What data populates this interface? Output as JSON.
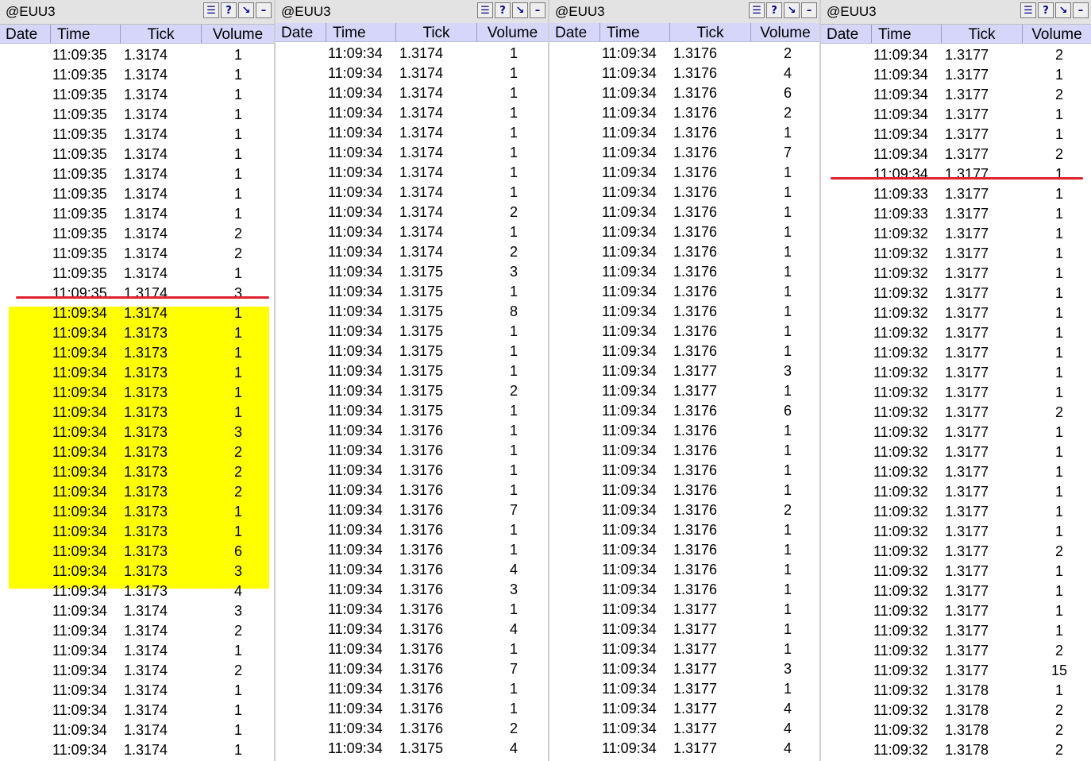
{
  "panels": [
    {
      "title": "@EUU3",
      "columns": [
        "Date",
        "Time",
        "Tick",
        "Volume"
      ],
      "highlight": {
        "from": 13,
        "to": 26,
        "color": "#ffff00"
      },
      "red_line_after_row": 12,
      "rows": [
        [
          "11:09:35",
          "1.3174",
          "1"
        ],
        [
          "11:09:35",
          "1.3174",
          "1"
        ],
        [
          "11:09:35",
          "1.3174",
          "1"
        ],
        [
          "11:09:35",
          "1.3174",
          "1"
        ],
        [
          "11:09:35",
          "1.3174",
          "1"
        ],
        [
          "11:09:35",
          "1.3174",
          "1"
        ],
        [
          "11:09:35",
          "1.3174",
          "1"
        ],
        [
          "11:09:35",
          "1.3174",
          "1"
        ],
        [
          "11:09:35",
          "1.3174",
          "1"
        ],
        [
          "11:09:35",
          "1.3174",
          "2"
        ],
        [
          "11:09:35",
          "1.3174",
          "2"
        ],
        [
          "11:09:35",
          "1.3174",
          "1"
        ],
        [
          "11:09:35",
          "1.3174",
          "3"
        ],
        [
          "11:09:34",
          "1.3174",
          "1"
        ],
        [
          "11:09:34",
          "1.3173",
          "1"
        ],
        [
          "11:09:34",
          "1.3173",
          "1"
        ],
        [
          "11:09:34",
          "1.3173",
          "1"
        ],
        [
          "11:09:34",
          "1.3173",
          "1"
        ],
        [
          "11:09:34",
          "1.3173",
          "1"
        ],
        [
          "11:09:34",
          "1.3173",
          "3"
        ],
        [
          "11:09:34",
          "1.3173",
          "2"
        ],
        [
          "11:09:34",
          "1.3173",
          "2"
        ],
        [
          "11:09:34",
          "1.3173",
          "2"
        ],
        [
          "11:09:34",
          "1.3173",
          "1"
        ],
        [
          "11:09:34",
          "1.3173",
          "1"
        ],
        [
          "11:09:34",
          "1.3173",
          "6"
        ],
        [
          "11:09:34",
          "1.3173",
          "3"
        ],
        [
          "11:09:34",
          "1.3173",
          "4"
        ],
        [
          "11:09:34",
          "1.3174",
          "3"
        ],
        [
          "11:09:34",
          "1.3174",
          "2"
        ],
        [
          "11:09:34",
          "1.3174",
          "1"
        ],
        [
          "11:09:34",
          "1.3174",
          "2"
        ],
        [
          "11:09:34",
          "1.3174",
          "1"
        ],
        [
          "11:09:34",
          "1.3174",
          "1"
        ],
        [
          "11:09:34",
          "1.3174",
          "1"
        ],
        [
          "11:09:34",
          "1.3174",
          "1"
        ]
      ]
    },
    {
      "title": "@EUU3",
      "columns": [
        "Date",
        "Time",
        "Tick",
        "Volume"
      ],
      "highlight": null,
      "red_line_after_row": null,
      "rows": [
        [
          "11:09:34",
          "1.3174",
          "1"
        ],
        [
          "11:09:34",
          "1.3174",
          "1"
        ],
        [
          "11:09:34",
          "1.3174",
          "1"
        ],
        [
          "11:09:34",
          "1.3174",
          "1"
        ],
        [
          "11:09:34",
          "1.3174",
          "1"
        ],
        [
          "11:09:34",
          "1.3174",
          "1"
        ],
        [
          "11:09:34",
          "1.3174",
          "1"
        ],
        [
          "11:09:34",
          "1.3174",
          "1"
        ],
        [
          "11:09:34",
          "1.3174",
          "2"
        ],
        [
          "11:09:34",
          "1.3174",
          "1"
        ],
        [
          "11:09:34",
          "1.3174",
          "2"
        ],
        [
          "11:09:34",
          "1.3175",
          "3"
        ],
        [
          "11:09:34",
          "1.3175",
          "1"
        ],
        [
          "11:09:34",
          "1.3175",
          "8"
        ],
        [
          "11:09:34",
          "1.3175",
          "1"
        ],
        [
          "11:09:34",
          "1.3175",
          "1"
        ],
        [
          "11:09:34",
          "1.3175",
          "1"
        ],
        [
          "11:09:34",
          "1.3175",
          "2"
        ],
        [
          "11:09:34",
          "1.3175",
          "1"
        ],
        [
          "11:09:34",
          "1.3176",
          "1"
        ],
        [
          "11:09:34",
          "1.3176",
          "1"
        ],
        [
          "11:09:34",
          "1.3176",
          "1"
        ],
        [
          "11:09:34",
          "1.3176",
          "1"
        ],
        [
          "11:09:34",
          "1.3176",
          "7"
        ],
        [
          "11:09:34",
          "1.3176",
          "1"
        ],
        [
          "11:09:34",
          "1.3176",
          "1"
        ],
        [
          "11:09:34",
          "1.3176",
          "4"
        ],
        [
          "11:09:34",
          "1.3176",
          "3"
        ],
        [
          "11:09:34",
          "1.3176",
          "1"
        ],
        [
          "11:09:34",
          "1.3176",
          "4"
        ],
        [
          "11:09:34",
          "1.3176",
          "1"
        ],
        [
          "11:09:34",
          "1.3176",
          "7"
        ],
        [
          "11:09:34",
          "1.3176",
          "1"
        ],
        [
          "11:09:34",
          "1.3176",
          "1"
        ],
        [
          "11:09:34",
          "1.3176",
          "2"
        ],
        [
          "11:09:34",
          "1.3175",
          "4"
        ]
      ]
    },
    {
      "title": "@EUU3",
      "columns": [
        "Date",
        "Time",
        "Tick",
        "Volume"
      ],
      "highlight": null,
      "red_line_after_row": null,
      "rows": [
        [
          "11:09:34",
          "1.3176",
          "2"
        ],
        [
          "11:09:34",
          "1.3176",
          "4"
        ],
        [
          "11:09:34",
          "1.3176",
          "6"
        ],
        [
          "11:09:34",
          "1.3176",
          "2"
        ],
        [
          "11:09:34",
          "1.3176",
          "1"
        ],
        [
          "11:09:34",
          "1.3176",
          "7"
        ],
        [
          "11:09:34",
          "1.3176",
          "1"
        ],
        [
          "11:09:34",
          "1.3176",
          "1"
        ],
        [
          "11:09:34",
          "1.3176",
          "1"
        ],
        [
          "11:09:34",
          "1.3176",
          "1"
        ],
        [
          "11:09:34",
          "1.3176",
          "1"
        ],
        [
          "11:09:34",
          "1.3176",
          "1"
        ],
        [
          "11:09:34",
          "1.3176",
          "1"
        ],
        [
          "11:09:34",
          "1.3176",
          "1"
        ],
        [
          "11:09:34",
          "1.3176",
          "1"
        ],
        [
          "11:09:34",
          "1.3176",
          "1"
        ],
        [
          "11:09:34",
          "1.3177",
          "3"
        ],
        [
          "11:09:34",
          "1.3177",
          "1"
        ],
        [
          "11:09:34",
          "1.3176",
          "6"
        ],
        [
          "11:09:34",
          "1.3176",
          "1"
        ],
        [
          "11:09:34",
          "1.3176",
          "1"
        ],
        [
          "11:09:34",
          "1.3176",
          "1"
        ],
        [
          "11:09:34",
          "1.3176",
          "1"
        ],
        [
          "11:09:34",
          "1.3176",
          "2"
        ],
        [
          "11:09:34",
          "1.3176",
          "1"
        ],
        [
          "11:09:34",
          "1.3176",
          "1"
        ],
        [
          "11:09:34",
          "1.3176",
          "1"
        ],
        [
          "11:09:34",
          "1.3176",
          "1"
        ],
        [
          "11:09:34",
          "1.3177",
          "1"
        ],
        [
          "11:09:34",
          "1.3177",
          "1"
        ],
        [
          "11:09:34",
          "1.3177",
          "1"
        ],
        [
          "11:09:34",
          "1.3177",
          "3"
        ],
        [
          "11:09:34",
          "1.3177",
          "1"
        ],
        [
          "11:09:34",
          "1.3177",
          "4"
        ],
        [
          "11:09:34",
          "1.3177",
          "4"
        ],
        [
          "11:09:34",
          "1.3177",
          "4"
        ]
      ]
    },
    {
      "title": "@EUU3",
      "columns": [
        "Date",
        "Time",
        "Tick",
        "Volume"
      ],
      "highlight": null,
      "red_line_after_row": 6,
      "rows": [
        [
          "11:09:34",
          "1.3177",
          "2"
        ],
        [
          "11:09:34",
          "1.3177",
          "1"
        ],
        [
          "11:09:34",
          "1.3177",
          "2"
        ],
        [
          "11:09:34",
          "1.3177",
          "1"
        ],
        [
          "11:09:34",
          "1.3177",
          "1"
        ],
        [
          "11:09:34",
          "1.3177",
          "2"
        ],
        [
          "11:09:34",
          "1.3177",
          "1"
        ],
        [
          "11:09:33",
          "1.3177",
          "1"
        ],
        [
          "11:09:33",
          "1.3177",
          "1"
        ],
        [
          "11:09:32",
          "1.3177",
          "1"
        ],
        [
          "11:09:32",
          "1.3177",
          "1"
        ],
        [
          "11:09:32",
          "1.3177",
          "1"
        ],
        [
          "11:09:32",
          "1.3177",
          "1"
        ],
        [
          "11:09:32",
          "1.3177",
          "1"
        ],
        [
          "11:09:32",
          "1.3177",
          "1"
        ],
        [
          "11:09:32",
          "1.3177",
          "1"
        ],
        [
          "11:09:32",
          "1.3177",
          "1"
        ],
        [
          "11:09:32",
          "1.3177",
          "1"
        ],
        [
          "11:09:32",
          "1.3177",
          "2"
        ],
        [
          "11:09:32",
          "1.3177",
          "1"
        ],
        [
          "11:09:32",
          "1.3177",
          "1"
        ],
        [
          "11:09:32",
          "1.3177",
          "1"
        ],
        [
          "11:09:32",
          "1.3177",
          "1"
        ],
        [
          "11:09:32",
          "1.3177",
          "1"
        ],
        [
          "11:09:32",
          "1.3177",
          "1"
        ],
        [
          "11:09:32",
          "1.3177",
          "2"
        ],
        [
          "11:09:32",
          "1.3177",
          "1"
        ],
        [
          "11:09:32",
          "1.3177",
          "1"
        ],
        [
          "11:09:32",
          "1.3177",
          "1"
        ],
        [
          "11:09:32",
          "1.3177",
          "1"
        ],
        [
          "11:09:32",
          "1.3177",
          "2"
        ],
        [
          "11:09:32",
          "1.3177",
          "15"
        ],
        [
          "11:09:32",
          "1.3178",
          "1"
        ],
        [
          "11:09:32",
          "1.3178",
          "2"
        ],
        [
          "11:09:32",
          "1.3178",
          "2"
        ],
        [
          "11:09:32",
          "1.3178",
          "2"
        ]
      ]
    }
  ],
  "toolbar_icons": [
    "properties-icon",
    "help-icon",
    "pin-icon",
    "minimize-icon"
  ]
}
